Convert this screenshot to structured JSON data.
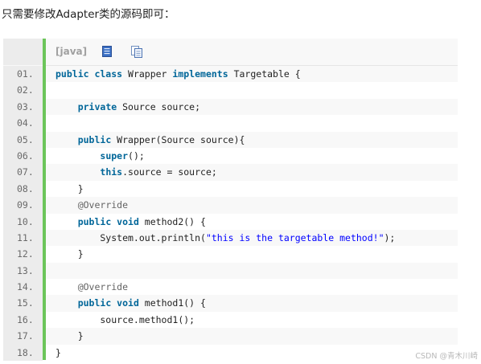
{
  "intro_text": "只需要修改Adapter类的源码即可：",
  "code_block": {
    "language_label": "[java]",
    "toolbar_icons": [
      "view-source-icon",
      "copy-icon"
    ],
    "lines": [
      {
        "num": "01.",
        "tokens": [
          {
            "t": "public class",
            "c": "kw"
          },
          {
            "t": " Wrapper ",
            "c": ""
          },
          {
            "t": "implements",
            "c": "kw"
          },
          {
            "t": " Targetable {",
            "c": ""
          }
        ]
      },
      {
        "num": "02.",
        "tokens": []
      },
      {
        "num": "03.",
        "tokens": [
          {
            "t": "    ",
            "c": ""
          },
          {
            "t": "private",
            "c": "kw"
          },
          {
            "t": " Source source;",
            "c": ""
          }
        ]
      },
      {
        "num": "04.",
        "tokens": []
      },
      {
        "num": "05.",
        "tokens": [
          {
            "t": "    ",
            "c": ""
          },
          {
            "t": "public",
            "c": "kw"
          },
          {
            "t": " Wrapper(Source source){",
            "c": ""
          }
        ]
      },
      {
        "num": "06.",
        "tokens": [
          {
            "t": "        ",
            "c": ""
          },
          {
            "t": "super",
            "c": "kw"
          },
          {
            "t": "();",
            "c": ""
          }
        ]
      },
      {
        "num": "07.",
        "tokens": [
          {
            "t": "        ",
            "c": ""
          },
          {
            "t": "this",
            "c": "kw"
          },
          {
            "t": ".source = source;",
            "c": ""
          }
        ]
      },
      {
        "num": "08.",
        "tokens": [
          {
            "t": "    }",
            "c": ""
          }
        ]
      },
      {
        "num": "09.",
        "tokens": [
          {
            "t": "    ",
            "c": ""
          },
          {
            "t": "@Override",
            "c": "an"
          }
        ]
      },
      {
        "num": "10.",
        "tokens": [
          {
            "t": "    ",
            "c": ""
          },
          {
            "t": "public void",
            "c": "kw"
          },
          {
            "t": " method2() {",
            "c": ""
          }
        ]
      },
      {
        "num": "11.",
        "tokens": [
          {
            "t": "        System.out.println(",
            "c": ""
          },
          {
            "t": "\"this is the targetable method!\"",
            "c": "str"
          },
          {
            "t": ");",
            "c": ""
          }
        ]
      },
      {
        "num": "12.",
        "tokens": [
          {
            "t": "    }",
            "c": ""
          }
        ]
      },
      {
        "num": "13.",
        "tokens": []
      },
      {
        "num": "14.",
        "tokens": [
          {
            "t": "    ",
            "c": ""
          },
          {
            "t": "@Override",
            "c": "an"
          }
        ]
      },
      {
        "num": "15.",
        "tokens": [
          {
            "t": "    ",
            "c": ""
          },
          {
            "t": "public void",
            "c": "kw"
          },
          {
            "t": " method1() {",
            "c": ""
          }
        ]
      },
      {
        "num": "16.",
        "tokens": [
          {
            "t": "        source.method1();",
            "c": ""
          }
        ]
      },
      {
        "num": "17.",
        "tokens": [
          {
            "t": "    }",
            "c": ""
          }
        ]
      },
      {
        "num": "18.",
        "tokens": [
          {
            "t": "}",
            "c": ""
          }
        ]
      }
    ]
  },
  "watermark": "CSDN @青木川崎",
  "colors": {
    "keyword": "#006699",
    "string": "#0000ff",
    "annotation": "#646464",
    "gutter_bar": "#6cc55a"
  }
}
